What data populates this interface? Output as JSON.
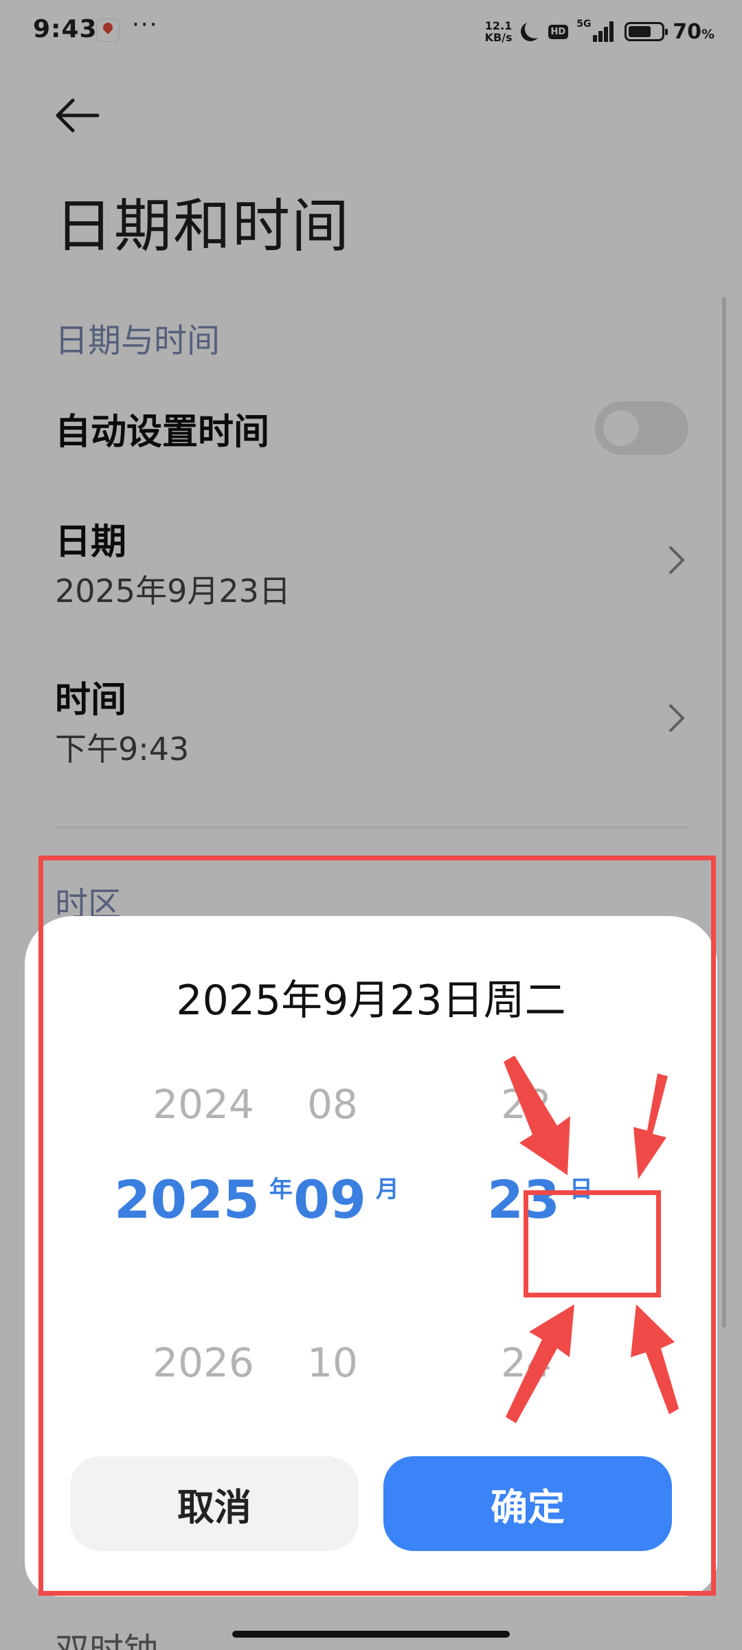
{
  "status_bar": {
    "time": "9:43",
    "more": "···",
    "net_speed_value": "12.1",
    "net_speed_unit": "KB/s",
    "hd": "HD",
    "network": "5G",
    "battery_percent_value": "70",
    "battery_percent_unit": "%",
    "battery_level": 0.7
  },
  "page": {
    "title": "日期和时间",
    "section_datetime": "日期与时间",
    "auto_time_label": "自动设置时间",
    "auto_time_enabled": false,
    "date_label": "日期",
    "date_value": "2025年9月23日",
    "time_label": "时间",
    "time_value": "下午9:43",
    "section_timezone": "时区",
    "next_section_peek": "双时钟"
  },
  "dialog": {
    "title": "2025年9月23日周二",
    "year": {
      "prev": "2024",
      "selected": "2025",
      "next": "2026",
      "unit": "年"
    },
    "month": {
      "prev": "08",
      "selected": "09",
      "next": "10",
      "unit": "月"
    },
    "day": {
      "prev": "22",
      "selected": "23",
      "next": "24",
      "unit": "日"
    },
    "cancel_label": "取消",
    "confirm_label": "确定"
  },
  "colors": {
    "accent": "#3a84f7",
    "selected_text": "#3a7fe0",
    "annotation_red": "#f04a48",
    "section_header": "#7a8ab3"
  }
}
